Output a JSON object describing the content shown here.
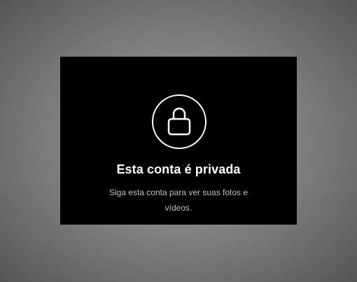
{
  "private_account": {
    "icon": "lock-icon",
    "title": "Esta conta é privada",
    "message": "Siga esta conta para ver suas fotos e vídeos."
  },
  "colors": {
    "panel_background": "#000000",
    "title_text": "#ffffff",
    "message_text": "#bfbfbf",
    "backdrop": "#808080"
  }
}
